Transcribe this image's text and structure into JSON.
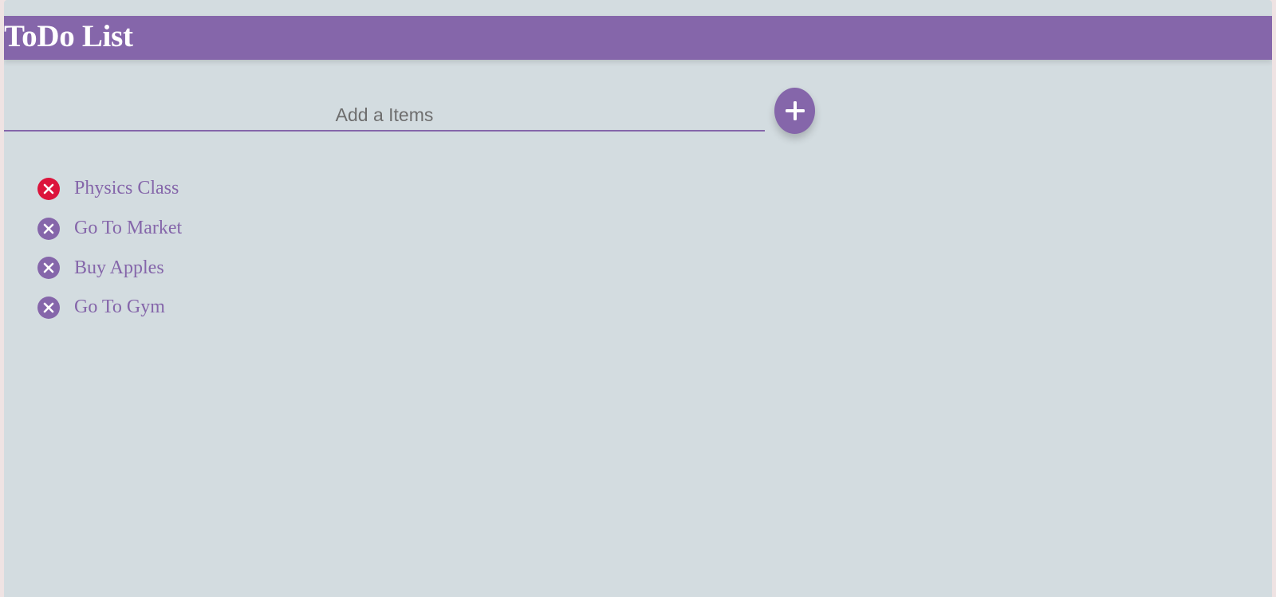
{
  "app": {
    "title": "ToDo List"
  },
  "input": {
    "placeholder": "Add a Items",
    "value": ""
  },
  "add_button": {
    "icon": "plus-icon"
  },
  "items": [
    {
      "text": "Physics Class",
      "delete_icon": "close-circle-icon",
      "hovered": true
    },
    {
      "text": "Go To Market",
      "delete_icon": "close-circle-icon",
      "hovered": false
    },
    {
      "text": "Buy Apples",
      "delete_icon": "close-circle-icon",
      "hovered": false
    },
    {
      "text": "Go To Gym",
      "delete_icon": "close-circle-icon",
      "hovered": false
    }
  ],
  "colors": {
    "accent": "#8566aa",
    "background": "#d3dce0",
    "danger": "#dc143c",
    "header_text": "#ffffff"
  }
}
